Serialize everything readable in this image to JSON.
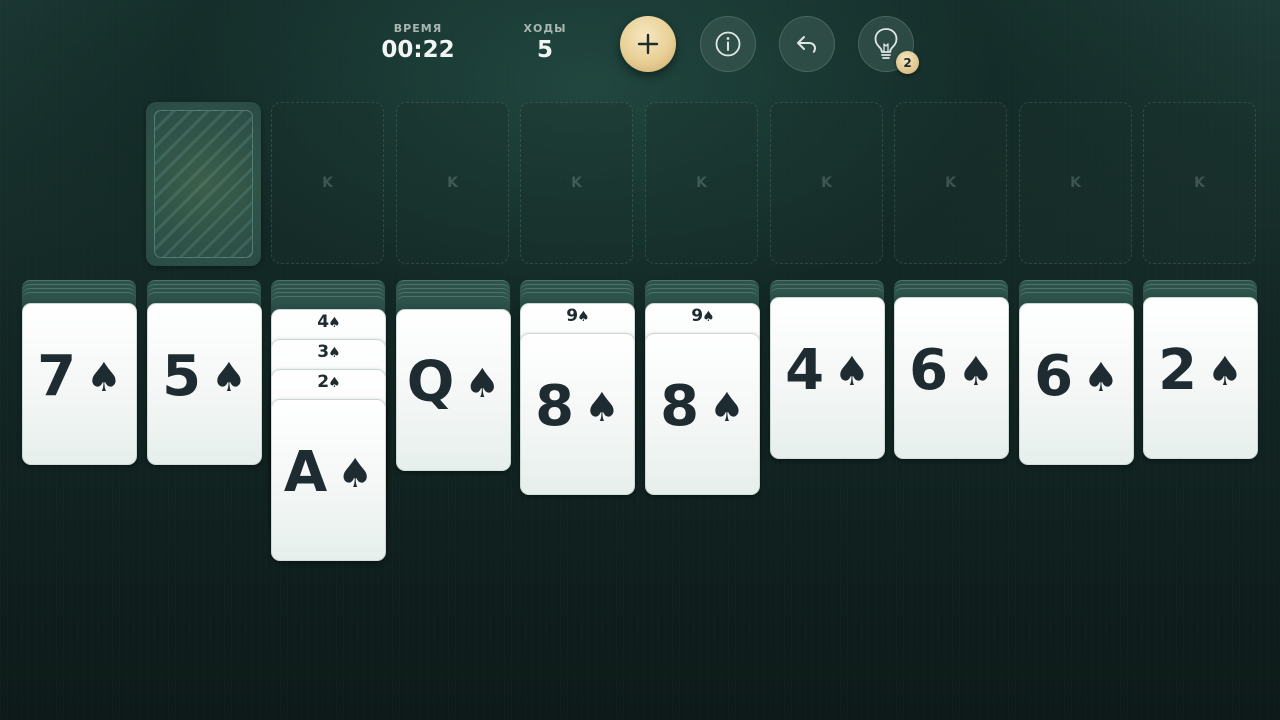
{
  "header": {
    "time_label": "ВРЕМЯ",
    "time_value": "00:22",
    "moves_label": "ХОДЫ",
    "moves_value": "5",
    "hint_count": "2"
  },
  "icons": {
    "new_game": "plus-icon",
    "info": "info-icon",
    "undo": "undo-arrow-icon",
    "hint": "lightbulb-icon",
    "stock": "card-back-pattern"
  },
  "colors": {
    "accent_gold": "#e8cf95",
    "card_face": "#f4f7f6",
    "card_ink": "#1e2b31",
    "felt": "#132724"
  },
  "foundations": [
    {
      "label": "K"
    },
    {
      "label": "K"
    },
    {
      "label": "K"
    },
    {
      "label": "K"
    },
    {
      "label": "K"
    },
    {
      "label": "K"
    },
    {
      "label": "K"
    },
    {
      "label": "K"
    }
  ],
  "tableau": [
    {
      "stacked_backs": 4,
      "face_up": [
        {
          "rank": "7",
          "suit": "♠"
        }
      ]
    },
    {
      "stacked_backs": 4,
      "face_up": [
        {
          "rank": "5",
          "suit": "♠"
        }
      ]
    },
    {
      "stacked_backs": 5,
      "face_up": [
        {
          "rank": "4",
          "suit": "♠"
        },
        {
          "rank": "3",
          "suit": "♠"
        },
        {
          "rank": "2",
          "suit": "♠"
        },
        {
          "rank": "A",
          "suit": "♠"
        }
      ]
    },
    {
      "stacked_backs": 5,
      "face_up": [
        {
          "rank": "Q",
          "suit": "♠"
        }
      ]
    },
    {
      "stacked_backs": 4,
      "face_up": [
        {
          "rank": "9",
          "suit": "♠"
        },
        {
          "rank": "8",
          "suit": "♠"
        }
      ]
    },
    {
      "stacked_backs": 4,
      "face_up": [
        {
          "rank": "9",
          "suit": "♠"
        },
        {
          "rank": "8",
          "suit": "♠"
        }
      ]
    },
    {
      "stacked_backs": 3,
      "face_up": [
        {
          "rank": "4",
          "suit": "♠"
        }
      ]
    },
    {
      "stacked_backs": 3,
      "face_up": [
        {
          "rank": "6",
          "suit": "♠"
        }
      ]
    },
    {
      "stacked_backs": 4,
      "face_up": [
        {
          "rank": "6",
          "suit": "♠"
        }
      ]
    },
    {
      "stacked_backs": 3,
      "face_up": [
        {
          "rank": "2",
          "suit": "♠"
        }
      ]
    }
  ]
}
